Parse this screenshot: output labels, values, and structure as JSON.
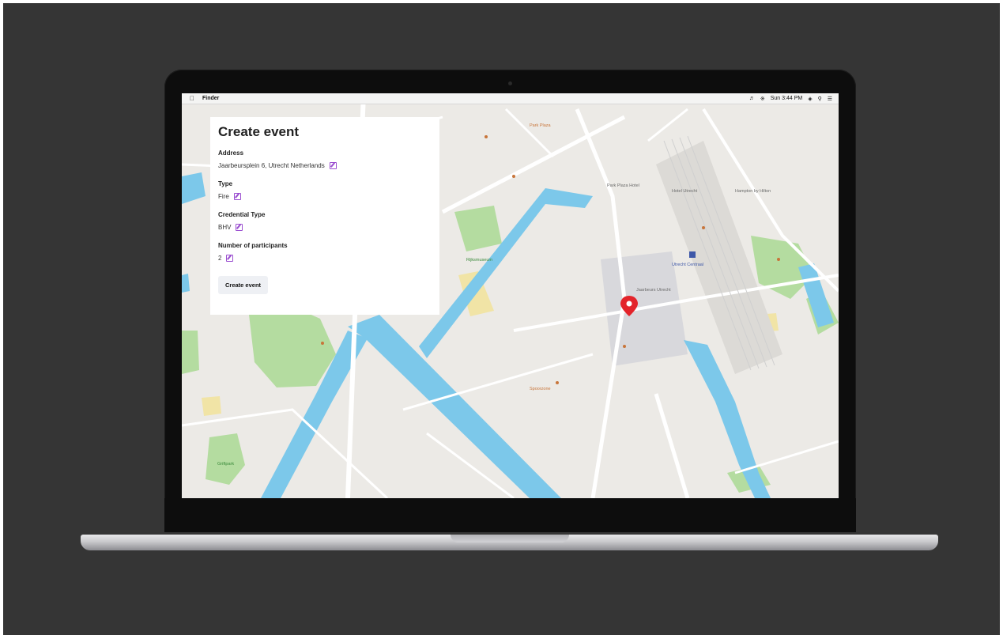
{
  "menubar": {
    "apple_icon": "apple-icon",
    "app_name": "Finder",
    "clock": "Sun 3:44 PM"
  },
  "panel": {
    "title": "Create event",
    "address_label": "Address",
    "address_value": "Jaarbeursplein 6, Utrecht Netherlands",
    "type_label": "Type",
    "type_value": "Fire",
    "credential_label": "Credential Type",
    "credential_value": "BHV",
    "participants_label": "Number of participants",
    "participants_value": "2",
    "submit_label": "Create event"
  },
  "map": {
    "station_label": "Utrecht Centraal",
    "labels": [
      "Park Plaza Hotel",
      "Hotel Utrecht",
      "Jaarbeurs Utrecht",
      "Rijksmuseum",
      "Hampton by Hilton",
      "Spoorzone",
      "Park Plaza",
      "Griftpark"
    ],
    "colors": {
      "water": "#7cc8ea",
      "park": "#b4dca0",
      "road": "#ffffff",
      "ground": "#eceae6",
      "marker": "#e3242b"
    }
  }
}
